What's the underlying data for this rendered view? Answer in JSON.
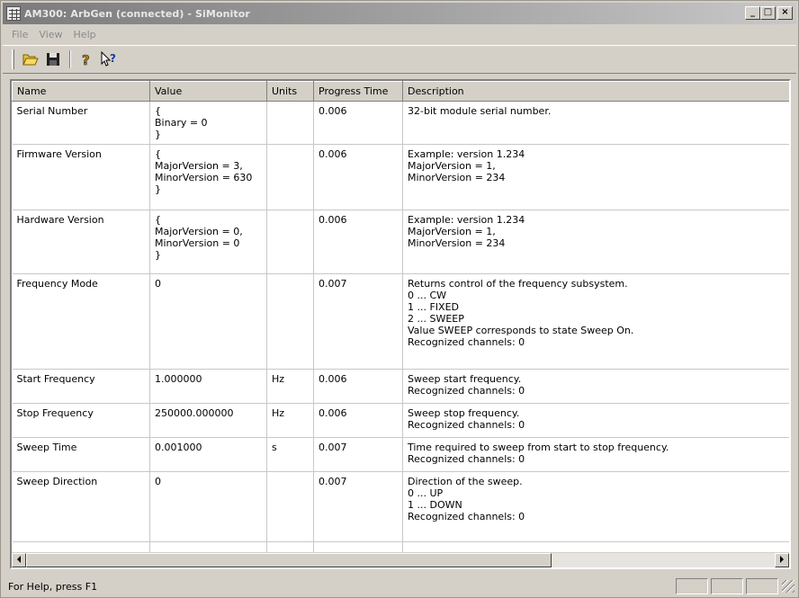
{
  "window": {
    "title": "AM300: ArbGen (connected) - SiMonitor",
    "controls": [
      "_",
      "□",
      "×"
    ]
  },
  "menu": [
    "File",
    "View",
    "Help"
  ],
  "toolbar": {
    "icons": [
      "open-folder-icon",
      "save-disk-icon",
      "help-icon",
      "context-help-icon"
    ]
  },
  "table": {
    "columns": [
      "Name",
      "Value",
      "Units",
      "Progress Time",
      "Description"
    ],
    "rows": [
      {
        "name": "Serial Number",
        "value": "{\nBinary = 0\n}",
        "units": "",
        "time": "0.006",
        "desc": "32-bit module serial number."
      },
      {
        "name": "Firmware Version",
        "value": "{\nMajorVersion = 3,\nMinorVersion = 630\n}",
        "units": "",
        "time": "0.006",
        "desc": "Example: version 1.234\nMajorVersion = 1,\nMinorVersion = 234"
      },
      {
        "name": "Hardware Version",
        "value": "{\nMajorVersion = 0,\nMinorVersion = 0\n}",
        "units": "",
        "time": "0.006",
        "desc": "Example: version 1.234\nMajorVersion = 1,\nMinorVersion = 234"
      },
      {
        "name": "Frequency Mode",
        "value": "0",
        "units": "",
        "time": "0.007",
        "desc": "Returns control of the frequency subsystem.\n0 ... CW\n1 ... FIXED\n2 ... SWEEP\nValue SWEEP corresponds to state Sweep On.\nRecognized channels: 0"
      },
      {
        "name": "Start Frequency",
        "value": "1.000000",
        "units": "Hz",
        "time": "0.006",
        "desc": "Sweep start frequency.\nRecognized channels: 0"
      },
      {
        "name": "Stop Frequency",
        "value": "250000.000000",
        "units": "Hz",
        "time": "0.006",
        "desc": "Sweep stop frequency.\nRecognized channels: 0"
      },
      {
        "name": "Sweep Time",
        "value": "0.001000",
        "units": "s",
        "time": "0.007",
        "desc": "Time required to sweep from start to stop frequency.\nRecognized channels: 0"
      },
      {
        "name": "Sweep Direction",
        "value": "0",
        "units": "",
        "time": "0.007",
        "desc": "Direction of the sweep.\n0 ... UP\n1 ... DOWN\nRecognized channels: 0"
      }
    ]
  },
  "status": {
    "text": "For Help, press F1"
  }
}
